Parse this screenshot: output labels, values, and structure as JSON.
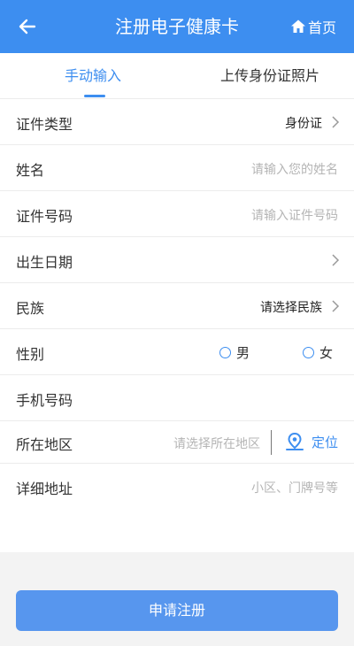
{
  "header": {
    "title": "注册电子健康卡",
    "home_label": "首页"
  },
  "tabs": [
    {
      "label": "手动输入",
      "active": true
    },
    {
      "label": "上传身份证照片",
      "active": false
    }
  ],
  "form": {
    "id_type": {
      "label": "证件类型",
      "value": "身份证"
    },
    "name": {
      "label": "姓名",
      "placeholder": "请输入您的姓名"
    },
    "id_number": {
      "label": "证件号码",
      "placeholder": "请输入证件号码"
    },
    "birth_date": {
      "label": "出生日期"
    },
    "ethnicity": {
      "label": "民族",
      "value": "请选择民族"
    },
    "gender": {
      "label": "性别",
      "options": [
        "男",
        "女"
      ]
    },
    "phone": {
      "label": "手机号码"
    },
    "region": {
      "label": "所在地区",
      "placeholder": "请选择所在地区",
      "locate_label": "定位"
    },
    "address": {
      "label": "详细地址",
      "placeholder": "小区、门牌号等"
    }
  },
  "submit_label": "申请注册",
  "colors": {
    "primary": "#3d8ef0",
    "button": "#5796ee"
  }
}
